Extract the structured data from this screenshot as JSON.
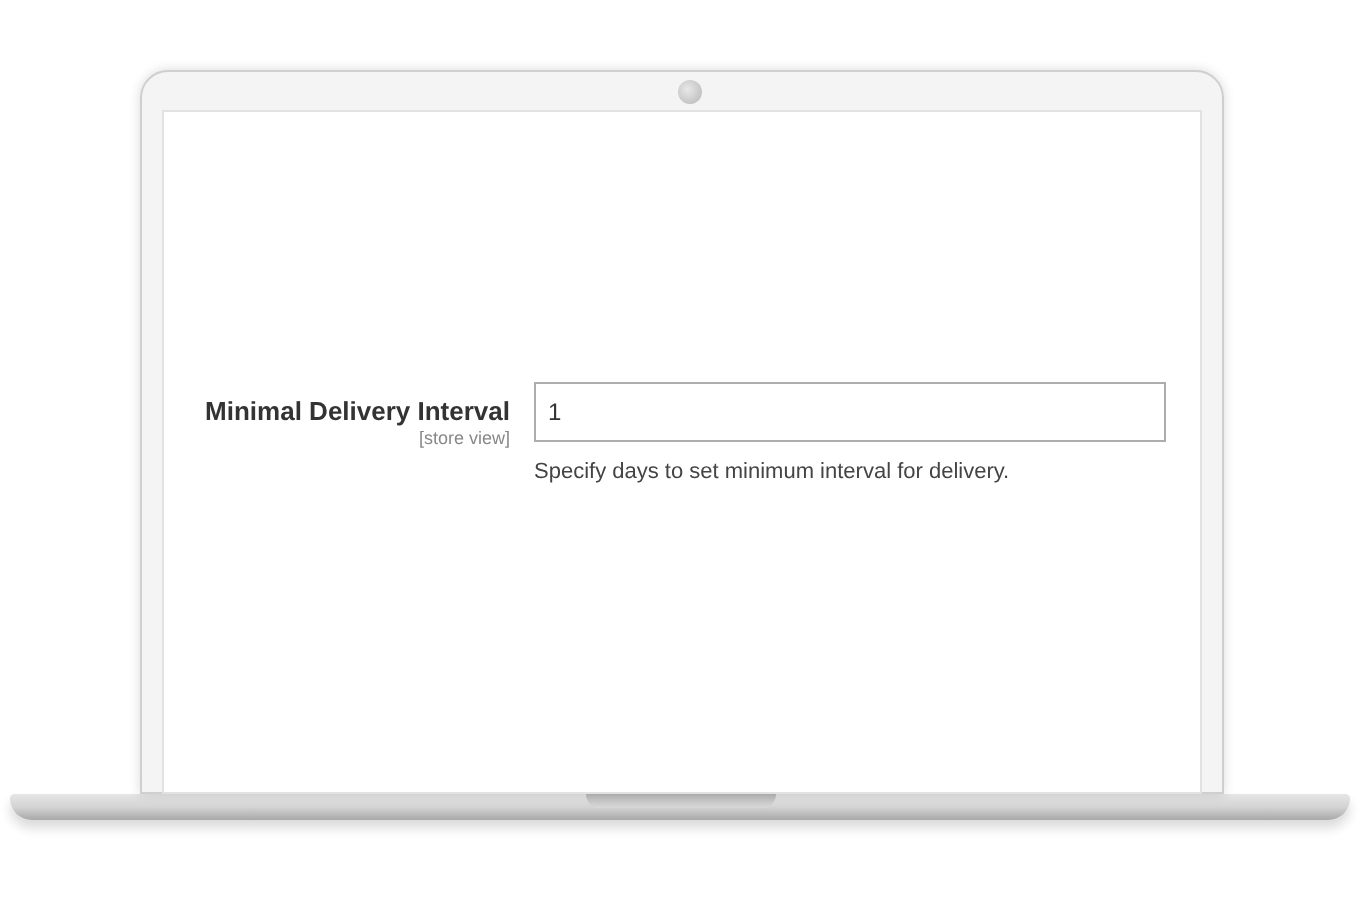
{
  "field": {
    "label": "Minimal Delivery Interval",
    "scope": "[store view]",
    "value": "1",
    "hint": "Specify days to set minimum interval for delivery."
  }
}
